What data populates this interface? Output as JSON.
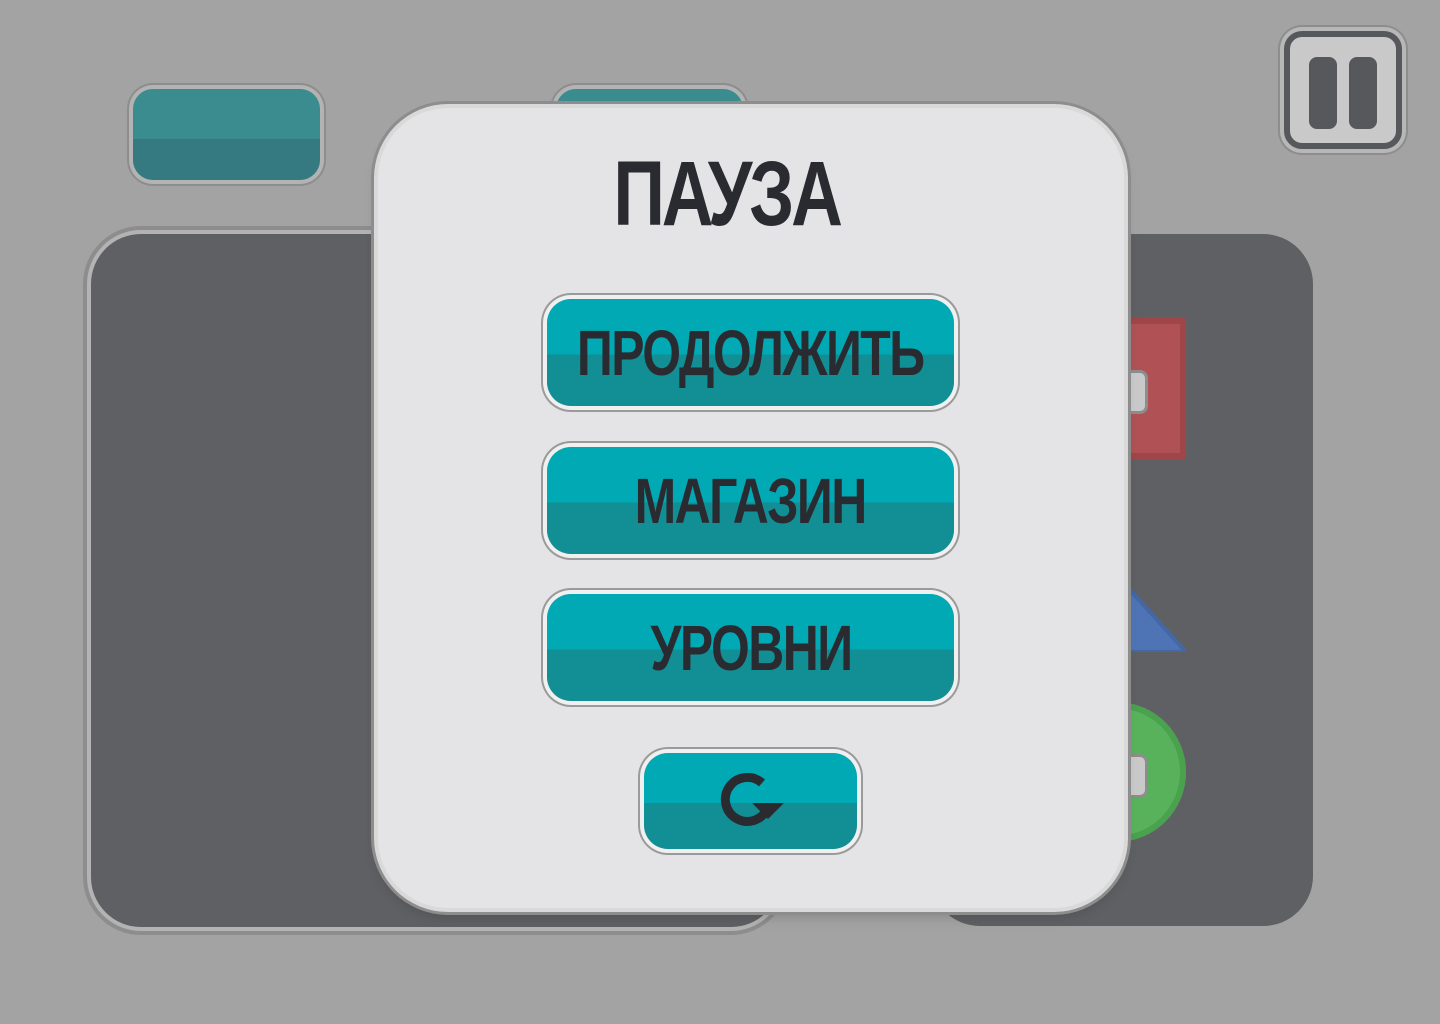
{
  "pause_menu": {
    "title": "ПАУЗА",
    "buttons": {
      "continue": "ПРОДОЛЖИТЬ",
      "shop": "МАГАЗИН",
      "levels": "УРОВНИ"
    },
    "restart_icon": "restart-icon"
  },
  "hud": {
    "pause_icon": "pause-icon"
  },
  "colors": {
    "background": "#a3a3a3",
    "modal": "#e4e3e5",
    "button_top": "#00a9b3",
    "button_bottom": "#128e95",
    "text": "#2a2b30",
    "panel_dark": "#5f6064",
    "shape_red": "#b05255",
    "shape_blue": "#4f74b6",
    "shape_green": "#58b25b"
  }
}
